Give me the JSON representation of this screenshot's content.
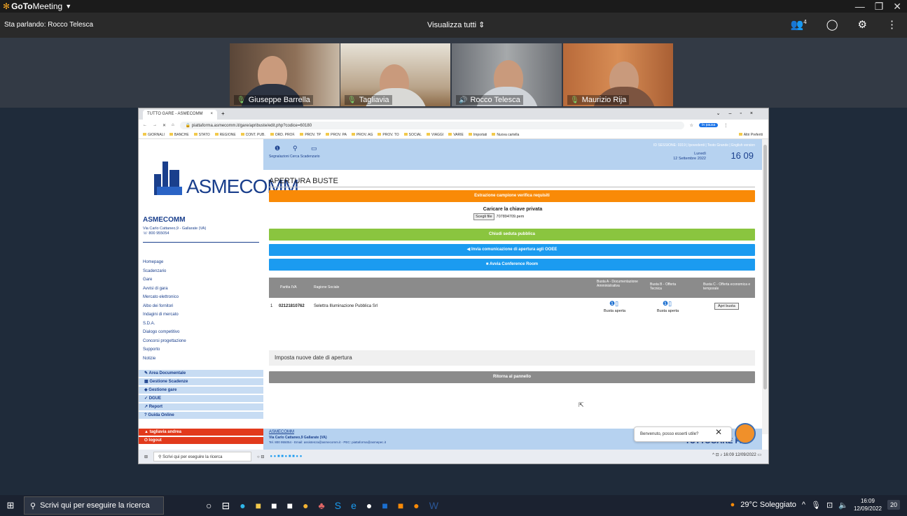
{
  "goto": {
    "app_brand_bold": "GoTo",
    "app_brand_rest": "Meeting",
    "speaking_label": "Sta parlando: Rocco Telesca",
    "view_all": "Visualizza tutti",
    "participant_count": "4"
  },
  "participants": [
    {
      "name": "Giuseppe Barrella"
    },
    {
      "name": "Tagliavia"
    },
    {
      "name": "Rocco Telesca"
    },
    {
      "name": "Maurizio Rija"
    }
  ],
  "chrome": {
    "tab_title": "TUTTO GARE - ASMECOMM",
    "url": "piattaforma.asmecomm.it/gare/apribuste/edit.php?codice=60180",
    "profile": "In pausa",
    "bookmarks": [
      "GIORNALI",
      "BANCHE",
      "STATO",
      "REGIONE",
      "CONT. PUB.",
      "ORD. PROF.",
      "PROV. TP",
      "PROV. PA",
      "PROV. AG",
      "PROV. TO",
      "SOCIAL",
      "VIAGGI",
      "VARIE",
      "Importati",
      "Nuova cartella"
    ],
    "other_bookmarks": "Altri Preferiti"
  },
  "left": {
    "logo_word": "ASMECOMM",
    "org_name": "ASMECOMM",
    "org_addr": "Via Carlo Cattaneo,9 - Gallarate (VA)",
    "org_phone": "800 955054",
    "menu": [
      "Homepage",
      "Scadenzario",
      "Gare",
      "Avvisi di gara",
      "Mercato elettronico",
      "Albo dei fornitori",
      "Indagini di mercato",
      "S.D.A.",
      "Dialogo competitivo",
      "Concorsi progettazione",
      "Supporto",
      "Notizie"
    ],
    "sections": [
      "Area Documentale",
      "Gestione Scadenze",
      "Gestione gare",
      "DGUE",
      "Report",
      "Guida Online"
    ],
    "user": "tagliavia andrea",
    "logout": "logout"
  },
  "topband": {
    "icons": [
      "Segnalazioni",
      "Cerca",
      "Scadenzario"
    ],
    "links": "ID SESSIONE: 0319 | Ipovedenti | Testo Grande | English version",
    "day": "Lunedì",
    "date": "12 Settembre 2022",
    "time_h": "16",
    "time_m": "09"
  },
  "main": {
    "title": "APERTURA BUSTE",
    "btn_estrazione": "Estrazione campione verifica requisiti",
    "key_title": "Caricare la chiave privata",
    "key_btn": "Scegli file",
    "key_file": "707894709.pem",
    "btn_chiudi": "Chiudi seduta pubblica",
    "btn_invia": "Invia comunicazione di apertura agli OOEE",
    "btn_avvia": "Avvia Conference Room",
    "table_headers": [
      "Partita IVA",
      "Ragione Sociale",
      "Busta A - Documentazione Amministrativa",
      "Busta B - Offerta Tecnica",
      "Busta C - Offerta economica e temporale"
    ],
    "row_num": "1",
    "row_piva": "02121810762",
    "row_name": "Selettra Illuminazione Pubblica Srl",
    "busta_a": "Busta aperta",
    "busta_b": "Busta aperta",
    "apri": "Apri busta",
    "imposta": "Imposta nuove date di apertura",
    "btn_ritorna": "Ritorna al pannello"
  },
  "footer": {
    "name": "ASMECOMM",
    "addr": "Via Carlo Cattaneo,9 Gallarate (VA)",
    "contacts": "Tel. 800 955054 - Email: assistenza@asmecomm.it - PEC: piattaforma@asmepec.it",
    "brand": "TUTTOGARE PA"
  },
  "chat": {
    "text": "Benvenuto, posso esserti utile?"
  },
  "inner_taskbar": {
    "search": "Scrivi qui per eseguire la ricerca",
    "time": "16:09",
    "date": "12/09/2022"
  },
  "taskbar": {
    "search": "Scrivi qui per eseguire la ricerca",
    "weather": "29°C Soleggiato",
    "time": "16:09",
    "date": "12/09/2022",
    "notifications": "20"
  },
  "colors": {
    "orange": "#f98a07",
    "green": "#8ac53f",
    "blue": "#1b9bf0",
    "gray": "#8b8b8b"
  }
}
